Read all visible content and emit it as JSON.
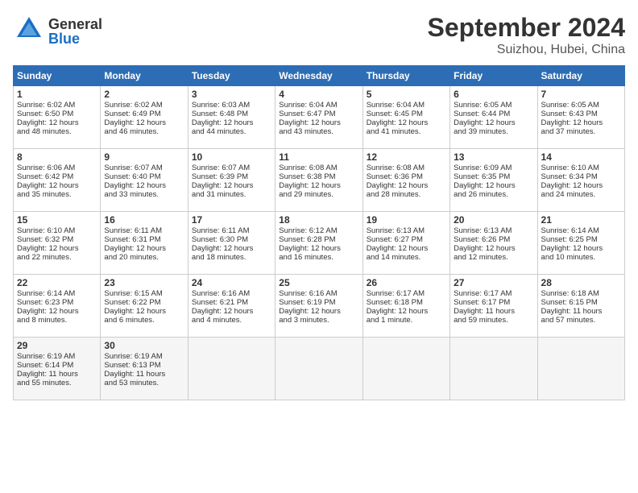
{
  "header": {
    "logo_general": "General",
    "logo_blue": "Blue",
    "month": "September 2024",
    "location": "Suizhou, Hubei, China"
  },
  "days_of_week": [
    "Sunday",
    "Monday",
    "Tuesday",
    "Wednesday",
    "Thursday",
    "Friday",
    "Saturday"
  ],
  "weeks": [
    [
      {
        "day": "1",
        "lines": [
          "Sunrise: 6:02 AM",
          "Sunset: 6:50 PM",
          "Daylight: 12 hours",
          "and 48 minutes."
        ]
      },
      {
        "day": "2",
        "lines": [
          "Sunrise: 6:02 AM",
          "Sunset: 6:49 PM",
          "Daylight: 12 hours",
          "and 46 minutes."
        ]
      },
      {
        "day": "3",
        "lines": [
          "Sunrise: 6:03 AM",
          "Sunset: 6:48 PM",
          "Daylight: 12 hours",
          "and 44 minutes."
        ]
      },
      {
        "day": "4",
        "lines": [
          "Sunrise: 6:04 AM",
          "Sunset: 6:47 PM",
          "Daylight: 12 hours",
          "and 43 minutes."
        ]
      },
      {
        "day": "5",
        "lines": [
          "Sunrise: 6:04 AM",
          "Sunset: 6:45 PM",
          "Daylight: 12 hours",
          "and 41 minutes."
        ]
      },
      {
        "day": "6",
        "lines": [
          "Sunrise: 6:05 AM",
          "Sunset: 6:44 PM",
          "Daylight: 12 hours",
          "and 39 minutes."
        ]
      },
      {
        "day": "7",
        "lines": [
          "Sunrise: 6:05 AM",
          "Sunset: 6:43 PM",
          "Daylight: 12 hours",
          "and 37 minutes."
        ]
      }
    ],
    [
      {
        "day": "8",
        "lines": [
          "Sunrise: 6:06 AM",
          "Sunset: 6:42 PM",
          "Daylight: 12 hours",
          "and 35 minutes."
        ]
      },
      {
        "day": "9",
        "lines": [
          "Sunrise: 6:07 AM",
          "Sunset: 6:40 PM",
          "Daylight: 12 hours",
          "and 33 minutes."
        ]
      },
      {
        "day": "10",
        "lines": [
          "Sunrise: 6:07 AM",
          "Sunset: 6:39 PM",
          "Daylight: 12 hours",
          "and 31 minutes."
        ]
      },
      {
        "day": "11",
        "lines": [
          "Sunrise: 6:08 AM",
          "Sunset: 6:38 PM",
          "Daylight: 12 hours",
          "and 29 minutes."
        ]
      },
      {
        "day": "12",
        "lines": [
          "Sunrise: 6:08 AM",
          "Sunset: 6:36 PM",
          "Daylight: 12 hours",
          "and 28 minutes."
        ]
      },
      {
        "day": "13",
        "lines": [
          "Sunrise: 6:09 AM",
          "Sunset: 6:35 PM",
          "Daylight: 12 hours",
          "and 26 minutes."
        ]
      },
      {
        "day": "14",
        "lines": [
          "Sunrise: 6:10 AM",
          "Sunset: 6:34 PM",
          "Daylight: 12 hours",
          "and 24 minutes."
        ]
      }
    ],
    [
      {
        "day": "15",
        "lines": [
          "Sunrise: 6:10 AM",
          "Sunset: 6:32 PM",
          "Daylight: 12 hours",
          "and 22 minutes."
        ]
      },
      {
        "day": "16",
        "lines": [
          "Sunrise: 6:11 AM",
          "Sunset: 6:31 PM",
          "Daylight: 12 hours",
          "and 20 minutes."
        ]
      },
      {
        "day": "17",
        "lines": [
          "Sunrise: 6:11 AM",
          "Sunset: 6:30 PM",
          "Daylight: 12 hours",
          "and 18 minutes."
        ]
      },
      {
        "day": "18",
        "lines": [
          "Sunrise: 6:12 AM",
          "Sunset: 6:28 PM",
          "Daylight: 12 hours",
          "and 16 minutes."
        ]
      },
      {
        "day": "19",
        "lines": [
          "Sunrise: 6:13 AM",
          "Sunset: 6:27 PM",
          "Daylight: 12 hours",
          "and 14 minutes."
        ]
      },
      {
        "day": "20",
        "lines": [
          "Sunrise: 6:13 AM",
          "Sunset: 6:26 PM",
          "Daylight: 12 hours",
          "and 12 minutes."
        ]
      },
      {
        "day": "21",
        "lines": [
          "Sunrise: 6:14 AM",
          "Sunset: 6:25 PM",
          "Daylight: 12 hours",
          "and 10 minutes."
        ]
      }
    ],
    [
      {
        "day": "22",
        "lines": [
          "Sunrise: 6:14 AM",
          "Sunset: 6:23 PM",
          "Daylight: 12 hours",
          "and 8 minutes."
        ]
      },
      {
        "day": "23",
        "lines": [
          "Sunrise: 6:15 AM",
          "Sunset: 6:22 PM",
          "Daylight: 12 hours",
          "and 6 minutes."
        ]
      },
      {
        "day": "24",
        "lines": [
          "Sunrise: 6:16 AM",
          "Sunset: 6:21 PM",
          "Daylight: 12 hours",
          "and 4 minutes."
        ]
      },
      {
        "day": "25",
        "lines": [
          "Sunrise: 6:16 AM",
          "Sunset: 6:19 PM",
          "Daylight: 12 hours",
          "and 3 minutes."
        ]
      },
      {
        "day": "26",
        "lines": [
          "Sunrise: 6:17 AM",
          "Sunset: 6:18 PM",
          "Daylight: 12 hours",
          "and 1 minute."
        ]
      },
      {
        "day": "27",
        "lines": [
          "Sunrise: 6:17 AM",
          "Sunset: 6:17 PM",
          "Daylight: 11 hours",
          "and 59 minutes."
        ]
      },
      {
        "day": "28",
        "lines": [
          "Sunrise: 6:18 AM",
          "Sunset: 6:15 PM",
          "Daylight: 11 hours",
          "and 57 minutes."
        ]
      }
    ],
    [
      {
        "day": "29",
        "lines": [
          "Sunrise: 6:19 AM",
          "Sunset: 6:14 PM",
          "Daylight: 11 hours",
          "and 55 minutes."
        ]
      },
      {
        "day": "30",
        "lines": [
          "Sunrise: 6:19 AM",
          "Sunset: 6:13 PM",
          "Daylight: 11 hours",
          "and 53 minutes."
        ]
      },
      {
        "day": "",
        "lines": []
      },
      {
        "day": "",
        "lines": []
      },
      {
        "day": "",
        "lines": []
      },
      {
        "day": "",
        "lines": []
      },
      {
        "day": "",
        "lines": []
      }
    ]
  ]
}
